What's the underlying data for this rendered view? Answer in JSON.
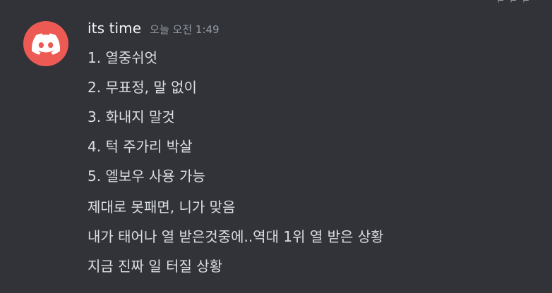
{
  "message": {
    "author": "its time",
    "timestamp": "오늘 오전 1:49",
    "avatar_icon": "discord-logo-icon",
    "avatar_color": "#ed5a54",
    "lines": [
      "1. 열중쉬엇",
      "2. 무표정, 말 없이",
      "3. 화내지 말것",
      "4. 턱 주가리 박살",
      "5. 엘보우 사용 가능",
      "제대로 못패면, 니가 맞음",
      "내가 태어나 열 받은것중에..역대 1위 열 받은 상황",
      "지금 진짜 일 터질 상황"
    ]
  },
  "colors": {
    "background": "#313338",
    "text": "#dbdee1",
    "author": "#f2f3f5",
    "muted": "#949ba4"
  }
}
